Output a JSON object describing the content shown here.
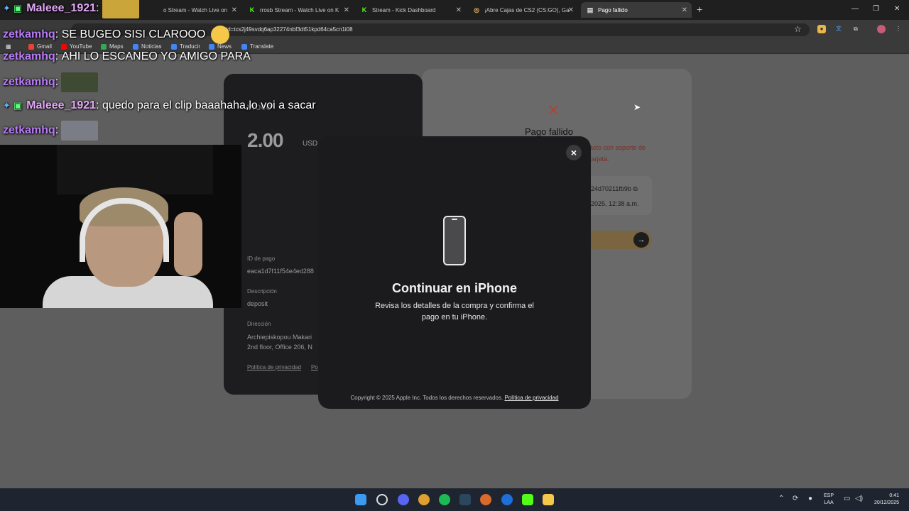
{
  "browser": {
    "tabs": [
      {
        "label": "o Stream - Watch Live on",
        "icon": "kick-icon"
      },
      {
        "label": "rrosb Stream - Watch Live on K",
        "icon": "kick-icon"
      },
      {
        "label": "Stream - Kick Dashboard",
        "icon": "kick-icon"
      },
      {
        "label": "¡Abre Cajas de CS2 (CS:GO), Ga",
        "icon": "globe-icon"
      },
      {
        "label": "Pago fallido",
        "icon": "page-icon"
      }
    ],
    "new_tab": "+",
    "url": "?sid=tcs2j49svdq6ap32274nbf3dt51kpd64ca5cn1i08",
    "bookmarks": [
      "Gmail",
      "YouTube",
      "Maps",
      "Noticias",
      "Traducir",
      "News",
      "Translate"
    ]
  },
  "payment_card": {
    "brand": "vroco",
    "amount": "2.00",
    "currency": "USD",
    "payment_id_label": "ID de pago",
    "payment_id_value": "eaca1d7f11f54e4ed288",
    "description_label": "Descripción",
    "description_value": "deposit",
    "address_label": "Dirección",
    "address_line1": "Archiepiskopou Makari",
    "address_line2": "2nd floor, Office 206, N",
    "privacy_link": "Política de privacidad",
    "other_link": "Po"
  },
  "status_card": {
    "title": "Pago fallido",
    "message": "acto con soporte de tarjeta.",
    "transaction_id": "24d70211fb9b",
    "date": "2025, 12:38 a.m."
  },
  "modal": {
    "title": "Continuar en iPhone",
    "body": "Revisa los detalles de la compra y confirma el pago en tu iPhone.",
    "footer": "Copyright © 2025 Apple Inc. Todos los derechos reservados.",
    "footer_link": "Política de privacidad",
    "close": "×"
  },
  "chat": [
    {
      "user": "Maleee_1921",
      "text": "",
      "style": "u2",
      "badges": true
    },
    {
      "user": "zetkamhq",
      "text": "SE BUGEO SISI CLAROOO",
      "style": "u1"
    },
    {
      "user": "zetkamhq",
      "text": "AHI LO ESCANEO YO AMIGO PARA",
      "style": "u1"
    },
    {
      "user": "zetkamhq",
      "text": "",
      "style": "u1"
    },
    {
      "user": "Maleee_1921",
      "text": "quedo para el clip baaahaha,lo voi a sacar",
      "style": "u2",
      "badges": true
    },
    {
      "user": "zetkamhq",
      "text": "",
      "style": "u1"
    }
  ],
  "taskbar": {
    "language": "ESP",
    "language_sub": "LAA",
    "time": "0:41",
    "date": "20/12/2025"
  },
  "colors": {
    "kick_green": "#53fc18",
    "error_red": "#a9473a",
    "modal_bg": "#1b1b1d"
  }
}
